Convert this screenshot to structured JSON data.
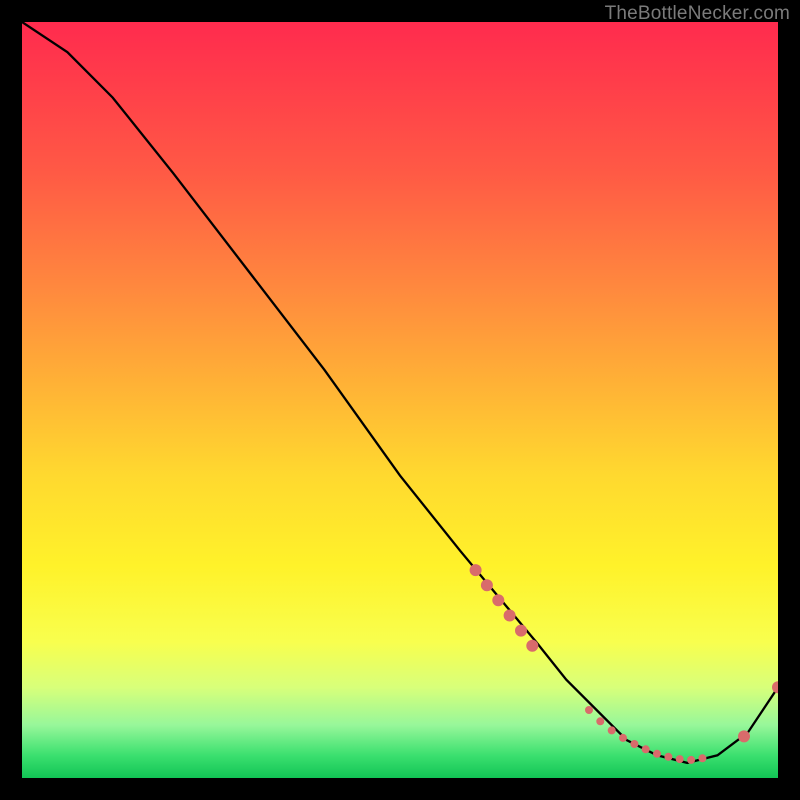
{
  "watermark": "TheBottleNecker.com",
  "chart_data": {
    "type": "line",
    "xlim": [
      0,
      100
    ],
    "ylim": [
      0,
      100
    ],
    "title": "",
    "xlabel": "",
    "ylabel": "",
    "line": {
      "color": "#000000",
      "x": [
        0,
        6,
        12,
        20,
        30,
        40,
        50,
        58,
        63,
        68,
        72,
        76,
        80,
        84,
        88,
        92,
        96,
        100
      ],
      "y": [
        100,
        96,
        90,
        80,
        67,
        54,
        40,
        30,
        24,
        18,
        13,
        9,
        5,
        3,
        2,
        3,
        6,
        12
      ]
    },
    "markers": {
      "color": "#d96b6b",
      "radius_small": 4,
      "radius_large": 6,
      "points": [
        {
          "x": 60.0,
          "y": 27.5,
          "r": "large"
        },
        {
          "x": 61.5,
          "y": 25.5,
          "r": "large"
        },
        {
          "x": 63.0,
          "y": 23.5,
          "r": "large"
        },
        {
          "x": 64.5,
          "y": 21.5,
          "r": "large"
        },
        {
          "x": 66.0,
          "y": 19.5,
          "r": "large"
        },
        {
          "x": 67.5,
          "y": 17.5,
          "r": "large"
        },
        {
          "x": 75.0,
          "y": 9.0,
          "r": "small"
        },
        {
          "x": 76.5,
          "y": 7.5,
          "r": "small"
        },
        {
          "x": 78.0,
          "y": 6.3,
          "r": "small"
        },
        {
          "x": 79.5,
          "y": 5.3,
          "r": "small"
        },
        {
          "x": 81.0,
          "y": 4.5,
          "r": "small"
        },
        {
          "x": 82.5,
          "y": 3.8,
          "r": "small"
        },
        {
          "x": 84.0,
          "y": 3.2,
          "r": "small"
        },
        {
          "x": 85.5,
          "y": 2.8,
          "r": "small"
        },
        {
          "x": 87.0,
          "y": 2.5,
          "r": "small"
        },
        {
          "x": 88.5,
          "y": 2.4,
          "r": "small"
        },
        {
          "x": 90.0,
          "y": 2.6,
          "r": "small"
        },
        {
          "x": 95.5,
          "y": 5.5,
          "r": "large"
        },
        {
          "x": 100.0,
          "y": 12.0,
          "r": "large"
        }
      ]
    }
  }
}
